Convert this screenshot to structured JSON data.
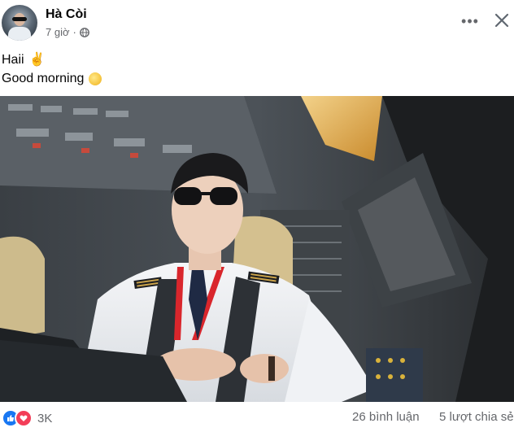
{
  "post": {
    "author": "Hà Còi",
    "time": "7 giờ",
    "privacy_icon": "globe-icon",
    "text_line1": "Haii",
    "emoji1": "✌",
    "text_line2": "Good morning",
    "emoji2_icon": "sun-emoji"
  },
  "header_actions": {
    "more": "•••",
    "close_icon": "close-icon"
  },
  "photo": {
    "subject": "cockpit-photo"
  },
  "footer": {
    "reactions_count": "3K",
    "comments": "26 bình luận",
    "shares": "5 lượt chia sẻ",
    "reaction_icons": [
      "like-icon",
      "love-icon"
    ],
    "colors": {
      "like": "#1877f2",
      "love": "#f33e58"
    }
  }
}
